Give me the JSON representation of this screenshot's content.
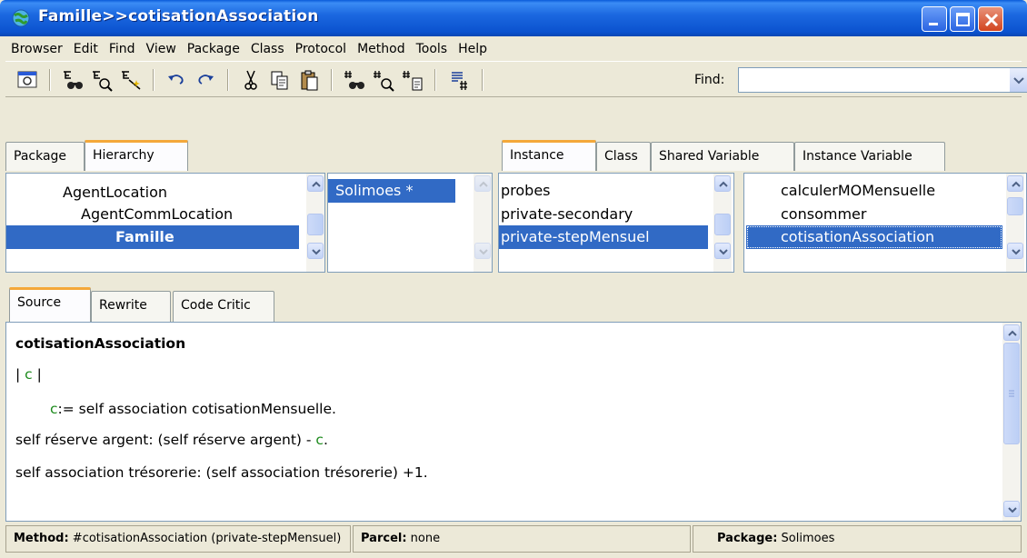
{
  "window": {
    "title": "Famille>>cotisationAssociation"
  },
  "menu": [
    "Browser",
    "Edit",
    "Find",
    "View",
    "Package",
    "Class",
    "Protocol",
    "Method",
    "Tools",
    "Help"
  ],
  "toolbar": {
    "find_label": "Find:",
    "find_value": ""
  },
  "top_left_tabs": [
    "Package",
    "Hierarchy"
  ],
  "top_right_tabs": [
    "Instance",
    "Class",
    "Shared Variable",
    "Instance Variable"
  ],
  "class_hierarchy": [
    "AgentLocation",
    "AgentCommLocation",
    "Famille"
  ],
  "packages": [
    "Solimoes *"
  ],
  "protocols": [
    "probes",
    "private-secondary",
    "private-stepMensuel"
  ],
  "methods": [
    "calculerMOMensuelle",
    "consommer",
    "cotisationAssociation"
  ],
  "code_tabs": [
    "Source",
    "Rewrite",
    "Code Critic"
  ],
  "code": {
    "line1": "cotisationAssociation",
    "line2_pre": "| ",
    "line2_var": "c",
    "line2_post": " |",
    "line3_var": "c",
    "line3_rest": ":= self association cotisationMensuelle.",
    "line4_pre": "self réserve argent: (self réserve argent) - ",
    "line4_var": "c",
    "line4_post": ".",
    "line5": "self association trésorerie: (self association trésorerie) +1."
  },
  "status": {
    "method_label": "Method:",
    "method_value": " #cotisationAssociation (private-stepMensuel)",
    "parcel_label": "Parcel:",
    "parcel_value": " none",
    "package_label": "Package:",
    "package_value": " Solimoes"
  },
  "colors": {
    "selection": "#316ac5",
    "variable": "#1b8a1b",
    "active_tab_accent": "#f4a83a"
  }
}
